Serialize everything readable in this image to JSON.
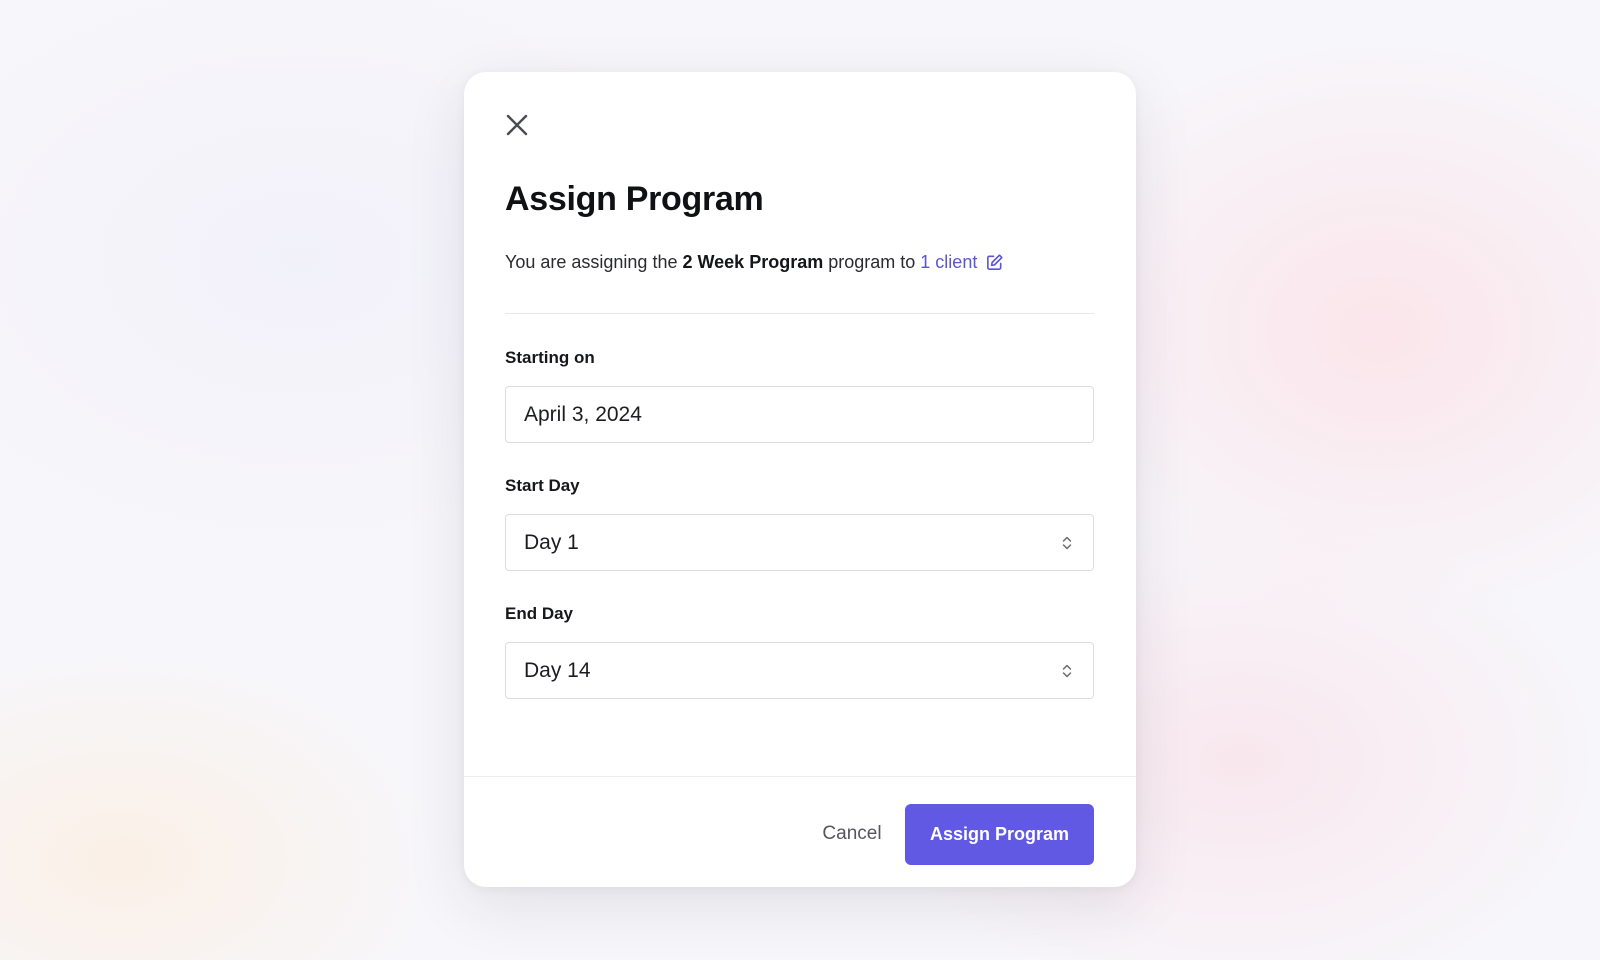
{
  "modal": {
    "title": "Assign Program",
    "subtitle": {
      "prefix": "You are assigning the",
      "program_name": "2 Week Program",
      "middle": "program to",
      "client_link": "1 client"
    },
    "fields": {
      "starting_on": {
        "label": "Starting on",
        "value": "April 3, 2024"
      },
      "start_day": {
        "label": "Start Day",
        "value": "Day 1"
      },
      "end_day": {
        "label": "End Day",
        "value": "Day 14"
      }
    },
    "buttons": {
      "cancel": "Cancel",
      "assign": "Assign Program"
    }
  },
  "icons": {
    "close": "close-icon",
    "edit": "edit-icon",
    "select": "chevron-up-down-icon"
  },
  "colors": {
    "accent": "#6159e3",
    "link": "#5b54d6",
    "text": "#15161a",
    "muted": "#55565e",
    "border": "#dcdce2"
  }
}
